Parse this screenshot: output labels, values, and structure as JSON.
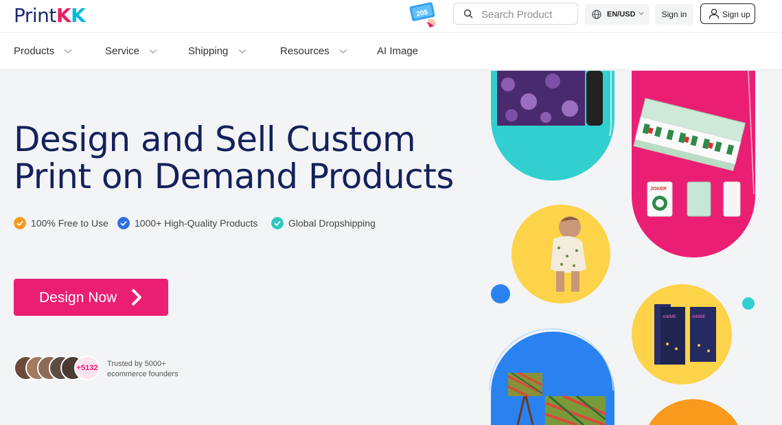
{
  "header": {
    "logo_text": "Print",
    "logo_k1": "K",
    "logo_k2": "K",
    "coupon_text": "20$",
    "search_placeholder": "Search Product",
    "language": "EN/USD",
    "signin": "Sign in",
    "signup": "Sign up"
  },
  "nav": {
    "items": [
      {
        "label": "Products"
      },
      {
        "label": "Service"
      },
      {
        "label": "Shipping"
      },
      {
        "label": "Resources"
      },
      {
        "label": "AI Image"
      }
    ]
  },
  "hero": {
    "headline_line1": "Design and Sell Custom",
    "headline_line2": "Print on Demand Products",
    "features": [
      {
        "label": "100% Free to Use",
        "color": "#f59c1e"
      },
      {
        "label": "1000+ High-Quality Products",
        "color": "#2d6fe0"
      },
      {
        "label": "Global Dropshipping",
        "color": "#2ec8c0"
      }
    ],
    "cta": "Design Now",
    "avatar_count": "+5132",
    "trusted_line1": "Trusted by 5000+",
    "trusted_line2": "ecommerce founders"
  },
  "collage": {
    "tile_text": "JOKER",
    "neon_text_1": "AIMME",
    "neon_text_2": "AIMME"
  },
  "colors": {
    "brand_navy": "#14215b",
    "brand_pink": "#ea1f73",
    "teal": "#31cfcf",
    "yellow": "#fdd34a",
    "blue": "#2a82f0"
  }
}
